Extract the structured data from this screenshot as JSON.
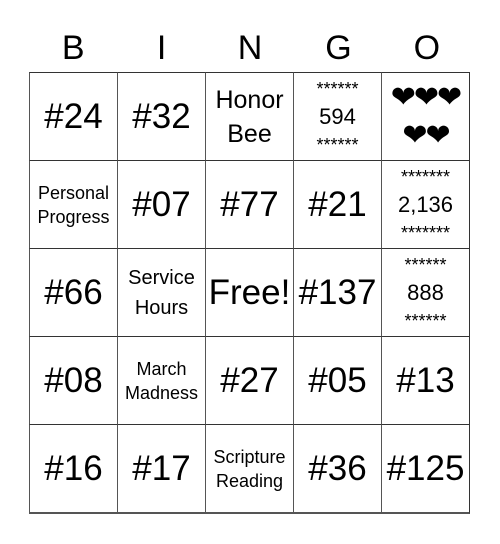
{
  "header": [
    "B",
    "I",
    "N",
    "G",
    "O"
  ],
  "cells": [
    {
      "type": "text",
      "size": "xl",
      "lines": [
        "#24"
      ]
    },
    {
      "type": "text",
      "size": "xl",
      "lines": [
        "#32"
      ]
    },
    {
      "type": "text",
      "size": "lg",
      "lines": [
        "Honor",
        "Bee"
      ]
    },
    {
      "type": "stars",
      "top": "******",
      "value": "594",
      "bottom": "******"
    },
    {
      "type": "hearts",
      "lines": [
        "❤❤❤",
        "❤❤"
      ]
    },
    {
      "type": "text",
      "size": "sm",
      "lines": [
        "Personal",
        "Progress"
      ]
    },
    {
      "type": "text",
      "size": "xl",
      "lines": [
        "#07"
      ]
    },
    {
      "type": "text",
      "size": "xl",
      "lines": [
        "#77"
      ]
    },
    {
      "type": "text",
      "size": "xl",
      "lines": [
        "#21"
      ]
    },
    {
      "type": "stars",
      "top": "*******",
      "value": "2,136",
      "bottom": "*******"
    },
    {
      "type": "text",
      "size": "xl",
      "lines": [
        "#66"
      ]
    },
    {
      "type": "text",
      "size": "md",
      "lines": [
        "Service",
        "Hours"
      ]
    },
    {
      "type": "text",
      "size": "xl",
      "lines": [
        "Free!"
      ]
    },
    {
      "type": "text",
      "size": "xl",
      "lines": [
        "#137"
      ]
    },
    {
      "type": "stars",
      "top": "******",
      "value": "888",
      "bottom": "******"
    },
    {
      "type": "text",
      "size": "xl",
      "lines": [
        "#08"
      ]
    },
    {
      "type": "text",
      "size": "sm",
      "lines": [
        "March",
        "Madness"
      ]
    },
    {
      "type": "text",
      "size": "xl",
      "lines": [
        "#27"
      ]
    },
    {
      "type": "text",
      "size": "xl",
      "lines": [
        "#05"
      ]
    },
    {
      "type": "text",
      "size": "xl",
      "lines": [
        "#13"
      ]
    },
    {
      "type": "text",
      "size": "xl",
      "lines": [
        "#16"
      ]
    },
    {
      "type": "text",
      "size": "xl",
      "lines": [
        "#17"
      ]
    },
    {
      "type": "text",
      "size": "sm",
      "lines": [
        "Scripture",
        "Reading"
      ]
    },
    {
      "type": "text",
      "size": "xl",
      "lines": [
        "#36"
      ]
    },
    {
      "type": "text",
      "size": "xl",
      "lines": [
        "#125"
      ]
    }
  ]
}
